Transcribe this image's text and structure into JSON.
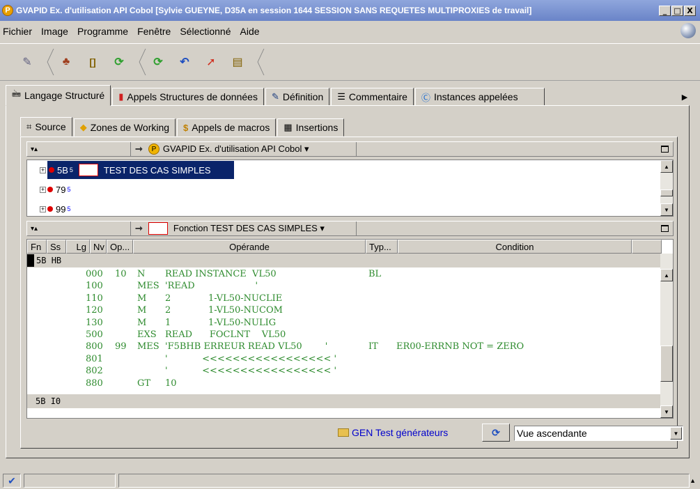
{
  "window": {
    "app_badge": "P",
    "title": "GVAPID Ex. d'utilisation API Cobol [Sylvie GUEYNE, D35A en session 1644 SESSION SANS REQUETES MULTIPROXIES de travail]",
    "btn_minimize": "_",
    "btn_maximize": "□",
    "btn_close": "X"
  },
  "menu": [
    "Fichier",
    "Image",
    "Programme",
    "Fenêtre",
    "Sélectionné",
    "Aide"
  ],
  "toolbar": {
    "icons": [
      "tag-icon",
      "wizard-icon",
      "brackets-icon",
      "refresh-green-icon",
      "refresh-green-icon-2",
      "undo-icon",
      "arrow-red-icon",
      "document-icon"
    ],
    "glyphs": [
      "✎",
      "♣",
      "[]",
      "⟳",
      "⟳",
      "↶",
      "➚",
      "▤"
    ]
  },
  "tabs": [
    {
      "label": "Langage Structuré",
      "icon": "🖮",
      "active": true
    },
    {
      "label": "Appels Structures de données",
      "icon": "▮"
    },
    {
      "label": "Définition",
      "icon": "✎"
    },
    {
      "label": "Commentaire",
      "icon": "☰"
    },
    {
      "label": "Instances appelées",
      "icon": "Ⓒ"
    }
  ],
  "tab_scroll": "▶",
  "inner_tabs": [
    {
      "label": "Source",
      "icon": "⌗",
      "active": true
    },
    {
      "label": "Zones de Working",
      "icon": "◆"
    },
    {
      "label": "Appels de macros",
      "icon": "$"
    },
    {
      "label": "Insertions",
      "icon": "▦"
    }
  ],
  "tree_header": {
    "collapse": "▾▴",
    "arrow": "➞",
    "badge": "P",
    "label": "GVAPID Ex. d'utilisation API Cobol ▾"
  },
  "tree": [
    {
      "code": "5B",
      "sup": "5",
      "label": "TEST DES CAS SIMPLES",
      "selected": true
    },
    {
      "code": "79",
      "sup": "5",
      "label": ""
    },
    {
      "code": "99",
      "sup": "5",
      "label": ""
    }
  ],
  "table_header": {
    "collapse": "▾▴",
    "arrow": "➞",
    "label": "Fonction TEST DES CAS SIMPLES ▾"
  },
  "columns": [
    "Fn",
    "Ss",
    "Lg",
    "Nv",
    "Op...",
    "Opérande",
    "Typ...",
    "Condition"
  ],
  "group_row": {
    "fn": "5B",
    "ss": "HB"
  },
  "group_row_bottom": {
    "fn": "5B",
    "ss": "I0"
  },
  "code_lines": [
    {
      "lg": "000",
      "nv": "10",
      "op": "N",
      "operand": "READ INSTANCE  VL50",
      "typ": "BL",
      "cond": ""
    },
    {
      "lg": "100",
      "nv": "",
      "op": "MES",
      "operand": "'READ                     '",
      "typ": "",
      "cond": ""
    },
    {
      "lg": "110",
      "nv": "",
      "op": "M",
      "operand": "2             1-VL50-NUCLIE",
      "typ": "",
      "cond": ""
    },
    {
      "lg": "120",
      "nv": "",
      "op": "M",
      "operand": "2             1-VL50-NUCOM",
      "typ": "",
      "cond": ""
    },
    {
      "lg": "130",
      "nv": "",
      "op": "M",
      "operand": "1             1-VL50-NULIG",
      "typ": "",
      "cond": ""
    },
    {
      "lg": "500",
      "nv": "",
      "op": "EXS",
      "operand": "READ      FOCLNT    VL50",
      "typ": "",
      "cond": ""
    },
    {
      "lg": "800",
      "nv": "99",
      "op": "MES",
      "operand": "'F5BHB ERREUR READ VL50        '",
      "typ": "IT",
      "cond": "ER00-ERRNB NOT = ZERO"
    },
    {
      "lg": "801",
      "nv": "",
      "op": "",
      "operand": "'            <<<<<<<<<<<<<<<<< '",
      "typ": "",
      "cond": ""
    },
    {
      "lg": "802",
      "nv": "",
      "op": "",
      "operand": "'            <<<<<<<<<<<<<<<<< '",
      "typ": "",
      "cond": ""
    },
    {
      "lg": "880",
      "nv": "",
      "op": "GT",
      "operand": "10",
      "typ": "",
      "cond": ""
    }
  ],
  "bottom": {
    "gen_link": "GEN Test générateurs",
    "refresh_glyph": "⟳",
    "view_select": "Vue ascendante"
  },
  "status": {
    "check": "✔",
    "up": "▲"
  },
  "scroll": {
    "up": "▲",
    "down": "▼"
  }
}
